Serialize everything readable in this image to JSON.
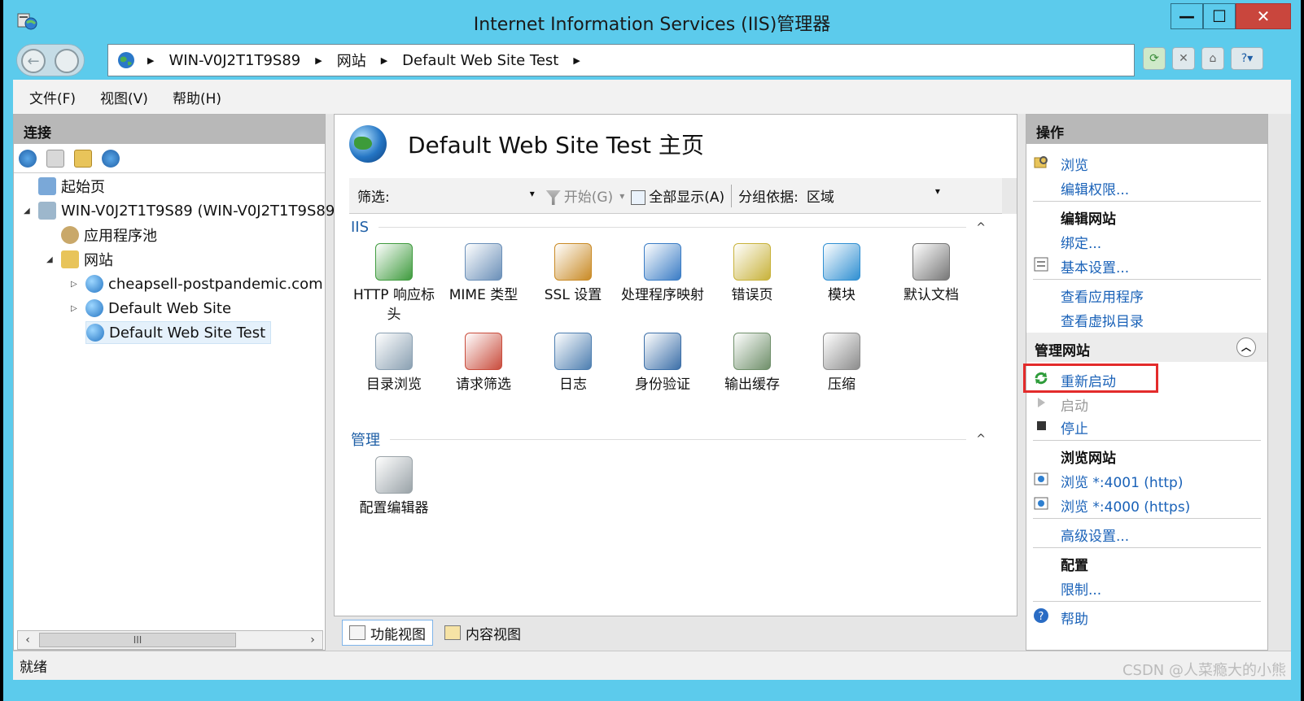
{
  "window": {
    "title": "Internet Information Services (IIS)管理器",
    "minimize": "—",
    "maximize": "☐",
    "close": "✕"
  },
  "address": {
    "segments": [
      "WIN-V0J2T1T9S89",
      "网站",
      "Default Web Site Test"
    ]
  },
  "menu": {
    "file": "文件(F)",
    "view": "视图(V)",
    "help": "帮助(H)"
  },
  "connections": {
    "header": "连接",
    "tree": {
      "start": "起始页",
      "server": "WIN-V0J2T1T9S89 (WIN-V0J2T1T9S89",
      "app_pools": "应用程序池",
      "sites": "网站",
      "site1": "cheapsell-postpandemic.com",
      "site2": "Default Web Site",
      "site3": "Default Web Site Test"
    },
    "scroll_thumb": "III"
  },
  "main": {
    "page_title": "Default Web Site Test 主页",
    "filter_label": "筛选:",
    "go_label": "开始(G)",
    "show_all_label": "全部显示(A)",
    "group_by_label": "分组依据:",
    "group_by_value": "区域",
    "section_iis": "IIS",
    "section_manage": "管理",
    "features": [
      {
        "label": "HTTP 响应标头",
        "icon": "http-response-headers-icon",
        "color": "#3f9b3e"
      },
      {
        "label": "MIME 类型",
        "icon": "mime-types-icon",
        "color": "#6a8fb8"
      },
      {
        "label": "SSL 设置",
        "icon": "ssl-lock-icon",
        "color": "#c98a25"
      },
      {
        "label": "处理程序映射",
        "icon": "handler-mappings-icon",
        "color": "#3a7cc5"
      },
      {
        "label": "错误页",
        "icon": "error-pages-icon",
        "color": "#c8b23a"
      },
      {
        "label": "模块",
        "icon": "modules-icon",
        "color": "#2f8fd2"
      },
      {
        "label": "默认文档",
        "icon": "default-document-icon",
        "color": "#777777"
      },
      {
        "label": "目录浏览",
        "icon": "directory-browsing-icon",
        "color": "#8aa0b2"
      },
      {
        "label": "请求筛选",
        "icon": "request-filtering-icon",
        "color": "#c94c3c"
      },
      {
        "label": "日志",
        "icon": "logging-icon",
        "color": "#4d7eb0"
      },
      {
        "label": "身份验证",
        "icon": "authentication-icon",
        "color": "#3c6fa8"
      },
      {
        "label": "输出缓存",
        "icon": "output-caching-icon",
        "color": "#6f8f6a"
      },
      {
        "label": "压缩",
        "icon": "compression-icon",
        "color": "#8c8c8c"
      }
    ],
    "manage_features": [
      {
        "label": "配置编辑器",
        "icon": "configuration-editor-icon",
        "color": "#9aa3a8"
      }
    ],
    "tabs": {
      "features_view": "功能视图",
      "content_view": "内容视图"
    }
  },
  "actions": {
    "header": "操作",
    "explore": "浏览",
    "edit_permissions": "编辑权限...",
    "edit_site_head": "编辑网站",
    "bindings": "绑定...",
    "basic_settings": "基本设置...",
    "view_apps": "查看应用程序",
    "view_vdirs": "查看虚拟目录",
    "manage_site_head": "管理网站",
    "restart": "重新启动",
    "start": "启动",
    "stop": "停止",
    "browse_site_head": "浏览网站",
    "browse_http": "浏览 *:4001 (http)",
    "browse_https": "浏览 *:4000 (https)",
    "advanced_settings": "高级设置...",
    "config_head": "配置",
    "limits": "限制...",
    "help": "帮助"
  },
  "status": {
    "text": "就绪"
  },
  "watermark": "CSDN @人菜瘾大的小熊",
  "colors": {
    "title_bar": "#5ccbec",
    "link": "#1a62b8",
    "highlight_box": "#e32b2b"
  }
}
